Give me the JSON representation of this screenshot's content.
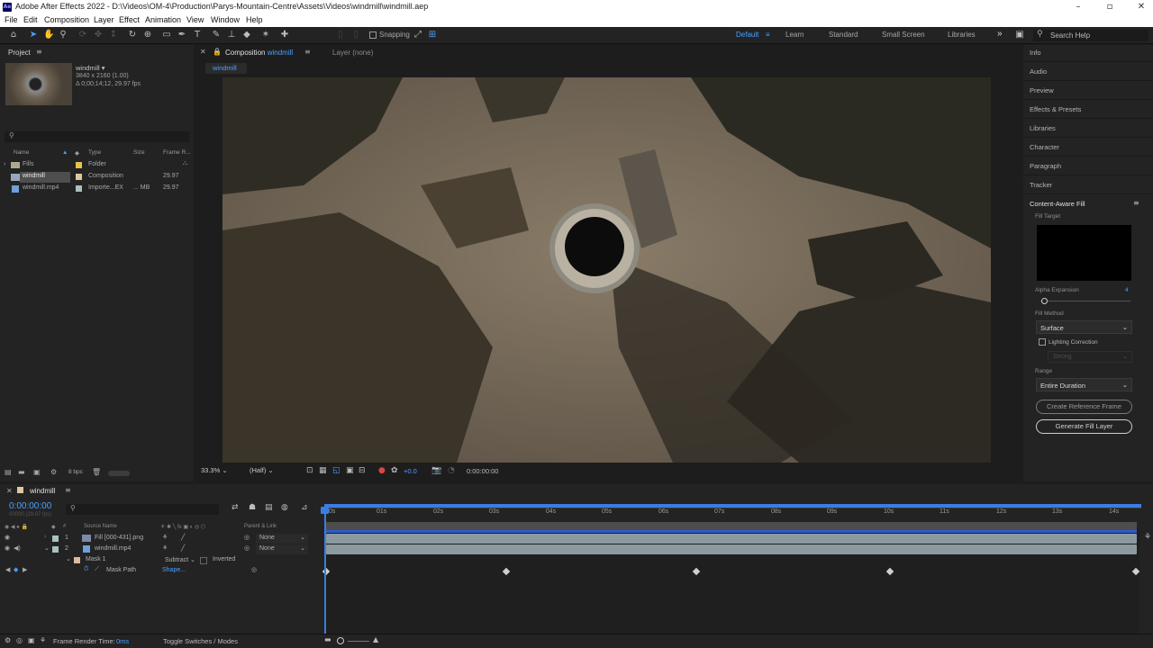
{
  "window": {
    "title": "Adobe After Effects 2022 - D:\\Videos\\OM-4\\Production\\Parys-Mountain-Centre\\Assets\\Videos\\windmill\\windmill.aep",
    "app_badge": "Ae"
  },
  "menu": [
    "File",
    "Edit",
    "Composition",
    "Layer",
    "Effect",
    "Animation",
    "View",
    "Window",
    "Help"
  ],
  "toolbar": {
    "snapping_label": "Snapping",
    "workspaces": [
      "Default",
      "Learn",
      "Standard",
      "Small Screen",
      "Libraries"
    ],
    "search_placeholder": "Search Help"
  },
  "project": {
    "tab": "Project",
    "item_name": "windmill",
    "item_info1": "3840 x 2160 (1.00)",
    "item_info2": "Δ 0;00;14;12, 29.97 fps",
    "columns": {
      "name": "Name",
      "type": "Type",
      "size": "Size",
      "frame": "Frame R..."
    },
    "rows": [
      {
        "name": "Fills",
        "type": "Folder",
        "size": "",
        "fps": ""
      },
      {
        "name": "windmill",
        "type": "Composition",
        "size": "",
        "fps": "29.97"
      },
      {
        "name": "windmill.mp4",
        "type": "Importe...EX",
        "size": "... MB",
        "fps": "29.97"
      }
    ],
    "bpc": "8 bpc"
  },
  "comp": {
    "tab": "Composition",
    "tab_name": "windmill",
    "layer_tab": "Layer (none)",
    "subtab": "windmill",
    "zoom": "33.3%",
    "resolution": "(Half)",
    "exposure": "+0.0",
    "timecode": "0:00:00:00"
  },
  "right_panel": {
    "items": [
      "Info",
      "Audio",
      "Preview",
      "Effects & Presets",
      "Libraries",
      "Character",
      "Paragraph",
      "Tracker"
    ],
    "caf": {
      "title": "Content-Aware Fill",
      "fill_target": "Fill Target",
      "alpha_expansion": "Alpha Expansion",
      "alpha_value": "4",
      "fill_method": "Fill Method",
      "fill_method_value": "Surface",
      "lighting": "Lighting Correction",
      "lighting_value": "Strong",
      "range": "Range",
      "range_value": "Entire Duration",
      "btn_ref": "Create Reference Frame",
      "btn_gen": "Generate Fill Layer"
    }
  },
  "timeline": {
    "tab": "windmill",
    "timecode": "0:00:00:00",
    "timecode_sub": "00000 (29.97 fps)",
    "col_source": "Source Name",
    "col_parent": "Parent & Link",
    "ruler": [
      "0s",
      "01s",
      "02s",
      "03s",
      "04s",
      "05s",
      "06s",
      "07s",
      "08s",
      "09s",
      "10s",
      "11s",
      "12s",
      "13s",
      "14s"
    ],
    "layers": [
      {
        "num": "1",
        "name": "Fill [000-431].png",
        "parent": "None"
      },
      {
        "num": "2",
        "name": "windmill.mp4",
        "parent": "None"
      }
    ],
    "mask": {
      "name": "Mask 1",
      "mode": "Subtract",
      "inverted": "Inverted",
      "prop": "Mask Path",
      "value": "Shape..."
    }
  },
  "status": {
    "frame_render_label": "Frame Render Time:",
    "frame_render_value": "0ms",
    "toggle": "Toggle Switches / Modes"
  }
}
